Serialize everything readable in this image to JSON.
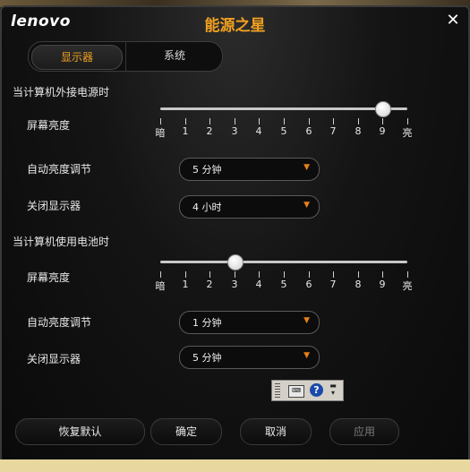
{
  "window": {
    "logo": "lenovo",
    "title": "能源之星",
    "close_label": "✕"
  },
  "tabs": [
    {
      "label": "显示器",
      "active": true
    },
    {
      "label": "系统",
      "active": false
    }
  ],
  "ac": {
    "section_title": "当计算机外接电源时",
    "brightness_label": "屏幕亮度",
    "brightness_level": 9,
    "auto_brightness_label": "自动亮度调节",
    "auto_brightness_value": "5 分钟",
    "display_off_label": "关闭显示器",
    "display_off_value": "4 小时"
  },
  "battery": {
    "section_title": "当计算机使用电池时",
    "brightness_label": "屏幕亮度",
    "brightness_level": 3,
    "auto_brightness_label": "自动亮度调节",
    "auto_brightness_value": "1 分钟",
    "display_off_label": "关闭显示器",
    "display_off_value": "5 分钟"
  },
  "slider_ticks": [
    "暗",
    "1",
    "2",
    "3",
    "4",
    "5",
    "6",
    "7",
    "8",
    "9",
    "亮"
  ],
  "buttons": {
    "restore": "恢复默认",
    "ok": "确定",
    "cancel": "取消",
    "apply": "应用"
  },
  "language_bar": {
    "keyboard_icon": "keyboard-icon",
    "help_glyph": "?"
  },
  "colors": {
    "accent": "#f0a020",
    "dropdown_arrow": "#e8801a"
  }
}
